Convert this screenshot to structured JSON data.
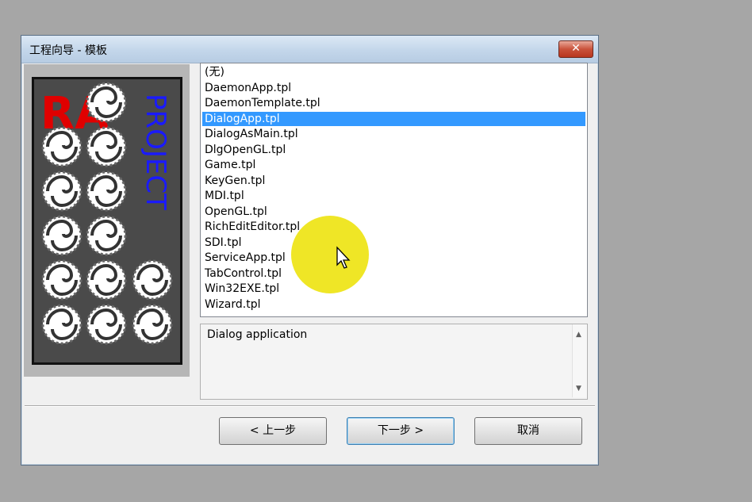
{
  "window": {
    "title": "工程向导 - 模板",
    "close_glyph": "✕"
  },
  "logo": {
    "text": "PROJECT",
    "mark": "RA",
    "mark_color": "#e00000",
    "text_color": "#1a1aff"
  },
  "templates": {
    "items": [
      "(无)",
      "DaemonApp.tpl",
      "DaemonTemplate.tpl",
      "DialogApp.tpl",
      "DialogAsMain.tpl",
      "DlgOpenGL.tpl",
      "Game.tpl",
      "KeyGen.tpl",
      "MDI.tpl",
      "OpenGL.tpl",
      "RichEditEditor.tpl",
      "SDI.tpl",
      "ServiceApp.tpl",
      "TabControl.tpl",
      "Win32EXE.tpl",
      "Wizard.tpl"
    ],
    "selected": "DialogApp.tpl"
  },
  "description": {
    "text": "Dialog application"
  },
  "buttons": {
    "back": "< 上一步",
    "next": "下一步 >",
    "cancel": "取消"
  },
  "colors": {
    "selection": "#3399ff",
    "highlight": "#ece200"
  }
}
